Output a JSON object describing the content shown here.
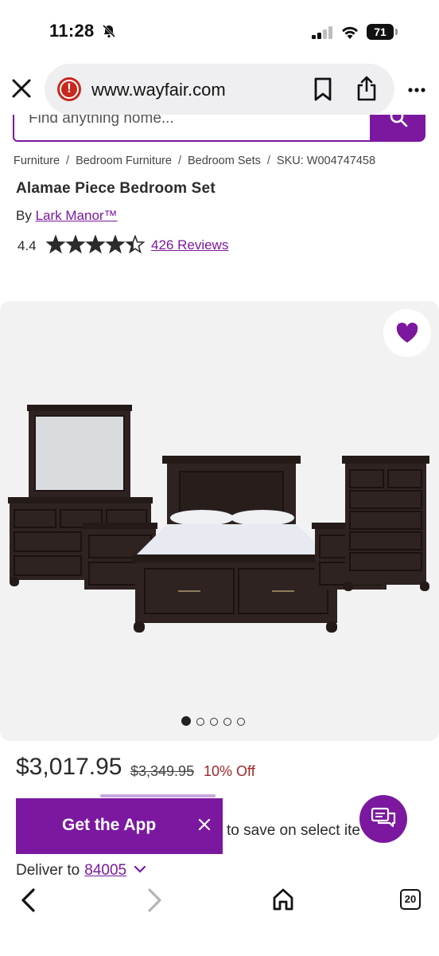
{
  "status_bar": {
    "time": "11:28",
    "battery": "71"
  },
  "browser": {
    "url": "www.wayfair.com"
  },
  "search": {
    "placeholder": "Find anything home..."
  },
  "breadcrumb": [
    "Furniture",
    "Bedroom Furniture",
    "Bedroom Sets",
    "SKU: W004747458"
  ],
  "product": {
    "title": "Alamae Piece Bedroom Set",
    "by_label": "By",
    "brand": "Lark Manor™",
    "rating": "4.4",
    "rating_value": 4.4,
    "reviews": "426 Reviews",
    "image_count": 5,
    "active_image": 1
  },
  "pricing": {
    "price": "$3,017.95",
    "original": "$3,349.95",
    "discount": "10% Off"
  },
  "banner": {
    "get_app": "Get the App",
    "save_text": "to save on select ite"
  },
  "delivery": {
    "label": "Deliver to",
    "zip": "84005"
  },
  "colors": {
    "accent": "#7b189f",
    "sale": "#a0262a",
    "panel": "#f2f2f2"
  }
}
